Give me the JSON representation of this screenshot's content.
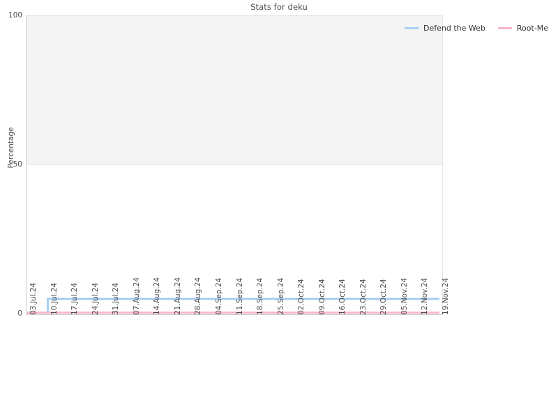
{
  "chart_data": {
    "type": "line",
    "title": "Stats for deku",
    "xlabel": "",
    "ylabel": "Percentage",
    "ylim": [
      0,
      100
    ],
    "yticks": [
      0,
      50,
      100
    ],
    "grid": true,
    "legend_position": "top-right",
    "categories": [
      "03.Jul.24",
      "10.Jul.24",
      "17.Jul.24",
      "24.Jul.24",
      "31.Jul.24",
      "07.Aug.24",
      "14.Aug.24",
      "21.Aug.24",
      "28.Aug.24",
      "04.Sep.24",
      "11.Sep.24",
      "18.Sep.24",
      "25.Sep.24",
      "02.Oct.24",
      "09.Oct.24",
      "16.Oct.24",
      "23.Oct.24",
      "29.Oct.24",
      "05.Nov.24",
      "12.Nov.24",
      "19.Nov.24"
    ],
    "series": [
      {
        "name": "Defend the Web",
        "color": "#a6cef0",
        "values": [
          0.5,
          5.1,
          5.1,
          5.1,
          5.1,
          5.1,
          5.1,
          5.1,
          5.1,
          5.1,
          5.1,
          5.1,
          5.1,
          5.1,
          5.1,
          5.1,
          5.1,
          5.1,
          5.1,
          5.1,
          5.1
        ]
      },
      {
        "name": "Root-Me",
        "color": "#f7b6cd",
        "values": [
          0.5,
          0.5,
          0.5,
          0.5,
          0.5,
          0.5,
          0.5,
          0.5,
          0.5,
          0.5,
          0.5,
          0.5,
          0.5,
          0.5,
          0.5,
          0.5,
          0.5,
          0.5,
          0.5,
          0.5,
          0.5
        ]
      }
    ]
  },
  "legend": {
    "items": [
      {
        "label": "Defend the Web",
        "color": "#a6cef0"
      },
      {
        "label": "Root-Me",
        "color": "#f7b6cd"
      }
    ]
  },
  "axis": {
    "y_label": "Percentage",
    "y_ticks": [
      "100",
      "50",
      "0"
    ]
  }
}
